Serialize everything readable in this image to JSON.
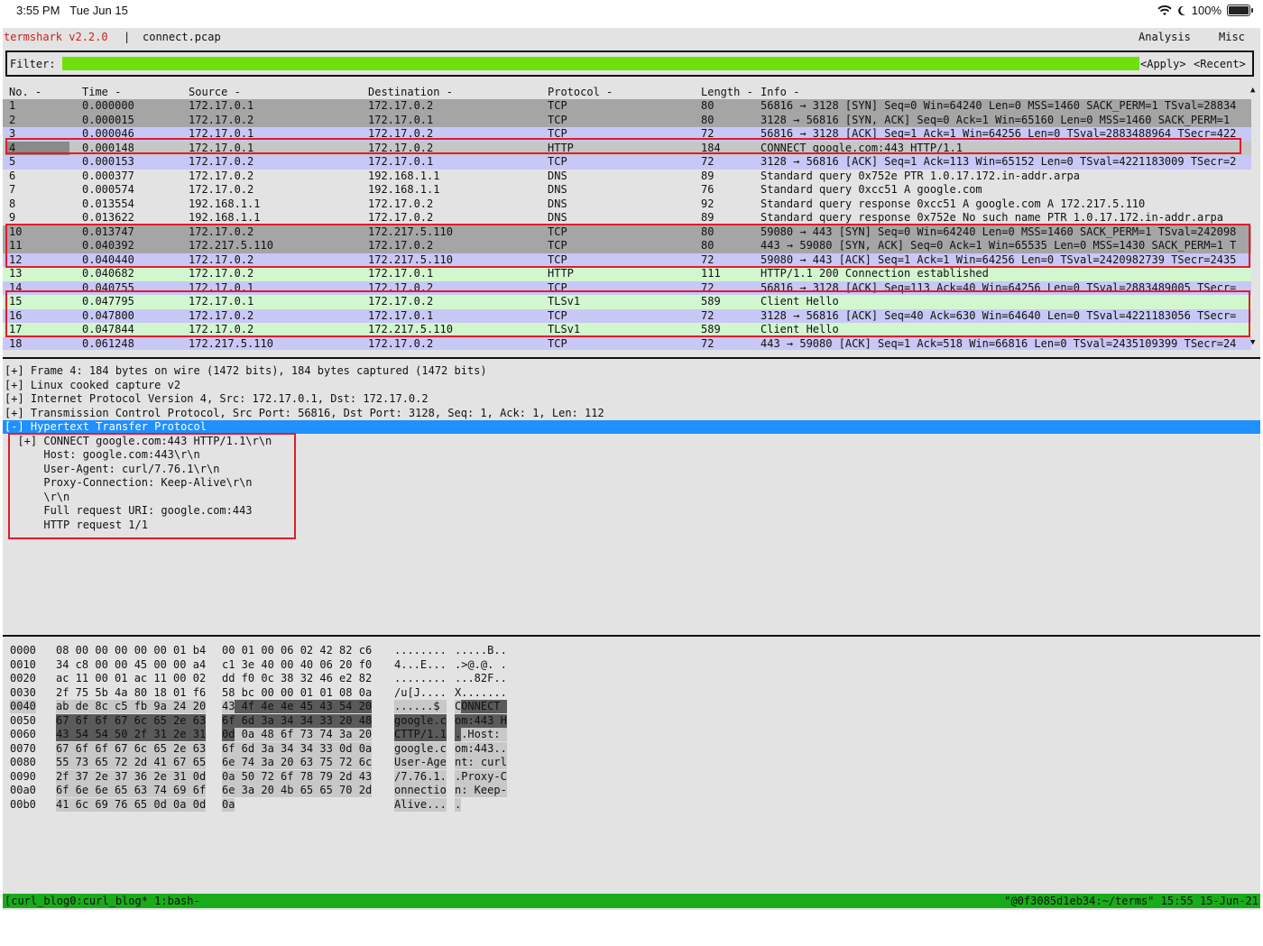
{
  "status_bar": {
    "time": "3:55 PM",
    "date": "Tue Jun 15",
    "battery": "100%",
    "icons": [
      "wifi-icon",
      "moon-icon",
      "battery-icon"
    ]
  },
  "titlebar": {
    "app": "termshark v2.2.0",
    "separator": "|",
    "file": "connect.pcap",
    "menu_analysis": "Analysis",
    "menu_misc": "Misc"
  },
  "filter": {
    "label": "Filter:",
    "value": "",
    "apply": "<Apply>",
    "recent": "<Recent>"
  },
  "packet_list": {
    "headers": [
      "No. -",
      "Time -",
      "Source -",
      "Destination -",
      "Protocol -",
      "Length -",
      "Info -"
    ],
    "rows": [
      {
        "no": "1",
        "time": "0.000000",
        "src": "172.17.0.1",
        "dst": "172.17.0.2",
        "proto": "TCP",
        "len": "80",
        "info": "56816 → 3128 [SYN] Seq=0 Win=64240 Len=0 MSS=1460 SACK_PERM=1 TSval=28834"
      },
      {
        "no": "2",
        "time": "0.000015",
        "src": "172.17.0.2",
        "dst": "172.17.0.1",
        "proto": "TCP",
        "len": "80",
        "info": "3128 → 56816 [SYN, ACK] Seq=0 Ack=1 Win=65160 Len=0 MSS=1460 SACK_PERM=1"
      },
      {
        "no": "3",
        "time": "0.000046",
        "src": "172.17.0.1",
        "dst": "172.17.0.2",
        "proto": "TCP",
        "len": "72",
        "info": "56816 → 3128 [ACK] Seq=1 Ack=1 Win=64256 Len=0 TSval=2883488964 TSecr=422"
      },
      {
        "no": "4",
        "time": "0.000148",
        "src": "172.17.0.1",
        "dst": "172.17.0.2",
        "proto": "HTTP",
        "len": "184",
        "info": "CONNECT google.com:443 HTTP/1.1"
      },
      {
        "no": "5",
        "time": "0.000153",
        "src": "172.17.0.2",
        "dst": "172.17.0.1",
        "proto": "TCP",
        "len": "72",
        "info": "3128 → 56816 [ACK] Seq=1 Ack=113 Win=65152 Len=0 TSval=4221183009 TSecr=2"
      },
      {
        "no": "6",
        "time": "0.000377",
        "src": "172.17.0.2",
        "dst": "192.168.1.1",
        "proto": "DNS",
        "len": "89",
        "info": "Standard query 0x752e PTR 1.0.17.172.in-addr.arpa"
      },
      {
        "no": "7",
        "time": "0.000574",
        "src": "172.17.0.2",
        "dst": "192.168.1.1",
        "proto": "DNS",
        "len": "76",
        "info": "Standard query 0xcc51 A google.com"
      },
      {
        "no": "8",
        "time": "0.013554",
        "src": "192.168.1.1",
        "dst": "172.17.0.2",
        "proto": "DNS",
        "len": "92",
        "info": "Standard query response 0xcc51 A google.com A 172.217.5.110"
      },
      {
        "no": "9",
        "time": "0.013622",
        "src": "192.168.1.1",
        "dst": "172.17.0.2",
        "proto": "DNS",
        "len": "89",
        "info": "Standard query response 0x752e No such name PTR 1.0.17.172.in-addr.arpa"
      },
      {
        "no": "10",
        "time": "0.013747",
        "src": "172.17.0.2",
        "dst": "172.217.5.110",
        "proto": "TCP",
        "len": "80",
        "info": "59080 → 443 [SYN] Seq=0 Win=64240 Len=0 MSS=1460 SACK_PERM=1 TSval=242098"
      },
      {
        "no": "11",
        "time": "0.040392",
        "src": "172.217.5.110",
        "dst": "172.17.0.2",
        "proto": "TCP",
        "len": "80",
        "info": "443 → 59080 [SYN, ACK] Seq=0 Ack=1 Win=65535 Len=0 MSS=1430 SACK_PERM=1 T"
      },
      {
        "no": "12",
        "time": "0.040440",
        "src": "172.17.0.2",
        "dst": "172.217.5.110",
        "proto": "TCP",
        "len": "72",
        "info": "59080 → 443 [ACK] Seq=1 Ack=1 Win=64256 Len=0 TSval=2420982739 TSecr=2435"
      },
      {
        "no": "13",
        "time": "0.040682",
        "src": "172.17.0.2",
        "dst": "172.17.0.1",
        "proto": "HTTP",
        "len": "111",
        "info": "HTTP/1.1 200 Connection established"
      },
      {
        "no": "14",
        "time": "0.040755",
        "src": "172.17.0.1",
        "dst": "172.17.0.2",
        "proto": "TCP",
        "len": "72",
        "info": "56816 → 3128 [ACK] Seq=113 Ack=40 Win=64256 Len=0 TSval=2883489005 TSecr="
      },
      {
        "no": "15",
        "time": "0.047795",
        "src": "172.17.0.1",
        "dst": "172.17.0.2",
        "proto": "TLSv1",
        "len": "589",
        "info": "Client Hello"
      },
      {
        "no": "16",
        "time": "0.047800",
        "src": "172.17.0.2",
        "dst": "172.17.0.1",
        "proto": "TCP",
        "len": "72",
        "info": "3128 → 56816 [ACK] Seq=40 Ack=630 Win=64640 Len=0 TSval=4221183056 TSecr="
      },
      {
        "no": "17",
        "time": "0.047844",
        "src": "172.17.0.2",
        "dst": "172.217.5.110",
        "proto": "TLSv1",
        "len": "589",
        "info": "Client Hello"
      },
      {
        "no": "18",
        "time": "0.061248",
        "src": "172.217.5.110",
        "dst": "172.17.0.2",
        "proto": "TCP",
        "len": "72",
        "info": "443 → 59080 [ACK] Seq=1 Ack=518 Win=66816 Len=0 TSval=2435109399 TSecr=24"
      }
    ]
  },
  "details": {
    "lines": [
      "[+] Frame 4: 184 bytes on wire (1472 bits), 184 bytes captured (1472 bits)",
      "[+] Linux cooked capture v2",
      "[+] Internet Protocol Version 4, Src: 172.17.0.1, Dst: 172.17.0.2",
      "[+] Transmission Control Protocol, Src Port: 56816, Dst Port: 3128, Seq: 1, Ack: 1, Len: 112",
      "[-] Hypertext Transfer Protocol",
      "  [+] CONNECT google.com:443 HTTP/1.1\\r\\n",
      "      Host: google.com:443\\r\\n",
      "      User-Agent: curl/7.76.1\\r\\n",
      "      Proxy-Connection: Keep-Alive\\r\\n",
      "      \\r\\n",
      "      Full request URI: google.com:443",
      "      HTTP request 1/1"
    ]
  },
  "hex": {
    "rows": [
      {
        "off": "0000",
        "a": "08 00 00 00 00 00 01 b4",
        "b": "00 01 00 06 02 42 82 c6",
        "c": "........",
        "d": ".....B.."
      },
      {
        "off": "0010",
        "a": "34 c8 00 00 45 00 00 a4",
        "b": "c1 3e 40 00 40 06 20 f0",
        "c": "4...E...",
        "d": ".>@.@. ."
      },
      {
        "off": "0020",
        "a": "ac 11 00 01 ac 11 00 02",
        "b": "dd f0 0c 38 32 46 e2 82",
        "c": "........",
        "d": "...82F.."
      },
      {
        "off": "0030",
        "a": "2f 75 5b 4a 80 18 01 f6",
        "b": "58 bc 00 00 01 01 08 0a",
        "c": "/u[J....",
        "d": "X......."
      },
      {
        "off": "0040",
        "a": "ab de 8c c5 fb 9a 24 20",
        "b1": "43",
        "b2": " 4f 4e 4e 45 43 54 20",
        "c": "......$ ",
        "d1": "C",
        "d2": "ONNECT "
      },
      {
        "off": "0050",
        "a": "67 6f 6f 67 6c 65 2e 63",
        "b": "6f 6d 3a 34 34 33 20 48",
        "c": "google.c",
        "d": "om:443 H"
      },
      {
        "off": "0060",
        "a": "43 54 54 50 2f 31 2e 31",
        "b1": "0d",
        "b2": " 0a 48 6f 73 74 3a 20",
        "c": "CTTP/1.1",
        "d1": ".",
        "d2": ".Host: "
      },
      {
        "off": "0070",
        "a": "67 6f 6f 67 6c 65 2e 63",
        "b": "6f 6d 3a 34 34 33 0d 0a",
        "c": "google.c",
        "d": "om:443.."
      },
      {
        "off": "0080",
        "a": "55 73 65 72 2d 41 67 65",
        "b": "6e 74 3a 20 63 75 72 6c",
        "c": "User-Age",
        "d": "nt: curl"
      },
      {
        "off": "0090",
        "a": "2f 37 2e 37 36 2e 31 0d",
        "b": "0a 50 72 6f 78 79 2d 43",
        "c": "/7.76.1.",
        "d": ".Proxy-C"
      },
      {
        "off": "00a0",
        "a": "6f 6e 6e 65 63 74 69 6f",
        "b": "6e 3a 20 4b 65 65 70 2d",
        "c": "onnectio",
        "d": "n: Keep-"
      },
      {
        "off": "00b0",
        "a": "41 6c 69 76 65 0d 0a 0d",
        "b": "0a",
        "c": "Alive...",
        "d": "."
      }
    ]
  },
  "tmux": {
    "left": "[curl_blog0:curl_blog* 1:bash-",
    "right": "\"@0f3085d1eb34:~/terms\" 15:55 15-Jun-21"
  },
  "colors": {
    "app_title": "#cc1e1e",
    "filter_ok": "#6fe10a",
    "tcp_row": "#c8c8f6",
    "http_row": "#d2f7cf",
    "selected_tree": "#1e90ff",
    "tmux_bar": "#1aab1a",
    "annotation": "#e21c2a"
  }
}
